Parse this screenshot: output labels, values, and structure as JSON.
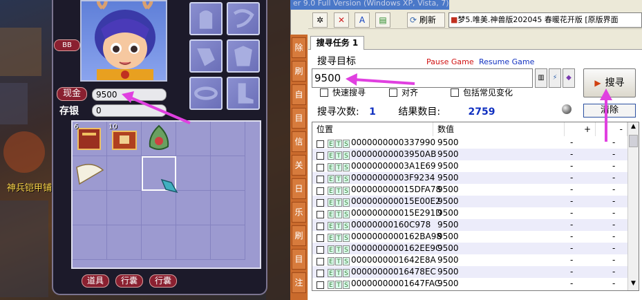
{
  "game": {
    "bg_text": "神兵铠甲铺",
    "bb_label": "BB",
    "cash_label": "现金",
    "cash_value": "9500",
    "savings_label": "存银",
    "savings_value": "0",
    "items": [
      {
        "name": "book",
        "count": "6"
      },
      {
        "name": "box",
        "count": "10"
      },
      {
        "name": "herb-pouch",
        "count": ""
      },
      {
        "name": "fan",
        "count": ""
      },
      {
        "name": "gem",
        "count": ""
      }
    ],
    "bottom_buttons": [
      "道具",
      "行囊",
      "行囊"
    ]
  },
  "ce": {
    "window_title": "er 9.0 Full Version (Windows XP, Vista, 7)",
    "refresh_label": "刷新",
    "game_title": "梦5.唯美.神兽版202045 春暖花开版 [原版界面",
    "left_tabs": [
      "除",
      "刷",
      "自",
      "目",
      "信",
      "关",
      "日",
      "乐",
      "刷",
      "目",
      "注"
    ],
    "tab_label": "搜寻任务 1",
    "target_label": "搜寻目标",
    "pause_label": "Pause Game",
    "resume_label": "Resume Game",
    "search_value": "9500",
    "options": [
      "快速搜寻",
      "对齐",
      "包括常见变化"
    ],
    "search_button": "搜寻",
    "search_count_label": "搜寻次数:",
    "search_count": "1",
    "result_label": "结果数目:",
    "result_count": "2759",
    "clear_button": "清除",
    "columns": [
      "位置",
      "数值",
      "+",
      "-"
    ],
    "rows": [
      [
        "0000000000337990",
        "9500"
      ],
      [
        "00000000003950AB",
        "9500"
      ],
      [
        "00000000003A1E69",
        "9500"
      ],
      [
        "00000000003F9234",
        "9500"
      ],
      [
        "000000000015DFA78",
        "9500"
      ],
      [
        "000000000015E00E2",
        "9500"
      ],
      [
        "000000000015E291D",
        "9500"
      ],
      [
        "00000000160C978",
        "9500"
      ],
      [
        "0000000000162BA98",
        "9500"
      ],
      [
        "0000000000162EE9C",
        "9500"
      ],
      [
        "0000000001642E8A",
        "9500"
      ],
      [
        "00000000016478EC",
        "9500"
      ],
      [
        "00000000001647FAC",
        "9500"
      ]
    ],
    "dash": "-",
    "tags": [
      "E",
      "T",
      "S"
    ]
  },
  "colors": {
    "arrow": "#e040e0",
    "accent_red": "#8a2030",
    "blue_value": "#1030c0"
  }
}
